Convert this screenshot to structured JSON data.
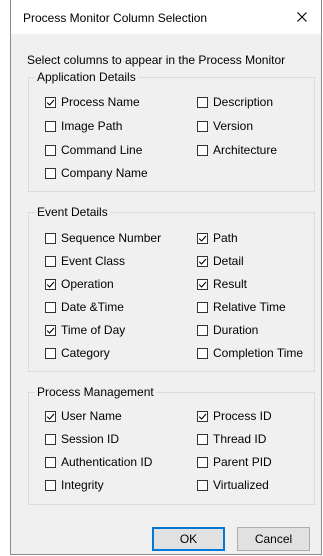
{
  "dialog": {
    "title": "Process Monitor Column Selection",
    "prompt": "Select columns to appear in the Process Monitor",
    "ok_label": "OK",
    "cancel_label": "Cancel"
  },
  "groups": {
    "application": {
      "title": "Application Details",
      "items": [
        {
          "label": "Process Name",
          "checked": true
        },
        {
          "label": "Description",
          "checked": false
        },
        {
          "label": "Image Path",
          "checked": false
        },
        {
          "label": "Version",
          "checked": false
        },
        {
          "label": "Command Line",
          "checked": false
        },
        {
          "label": "Architecture",
          "checked": false
        },
        {
          "label": "Company Name",
          "checked": false
        }
      ]
    },
    "event": {
      "title": "Event Details",
      "items": [
        {
          "label": "Sequence Number",
          "checked": false
        },
        {
          "label": "Path",
          "checked": true
        },
        {
          "label": "Event Class",
          "checked": false
        },
        {
          "label": "Detail",
          "checked": true
        },
        {
          "label": "Operation",
          "checked": true
        },
        {
          "label": "Result",
          "checked": true
        },
        {
          "label": "Date &Time",
          "checked": false
        },
        {
          "label": "Relative Time",
          "checked": false
        },
        {
          "label": "Time of Day",
          "checked": true
        },
        {
          "label": "Duration",
          "checked": false
        },
        {
          "label": "Category",
          "checked": false
        },
        {
          "label": "Completion Time",
          "checked": false
        }
      ]
    },
    "process": {
      "title": "Process Management",
      "items": [
        {
          "label": "User Name",
          "checked": true
        },
        {
          "label": "Process ID",
          "checked": true
        },
        {
          "label": "Session ID",
          "checked": false
        },
        {
          "label": "Thread ID",
          "checked": false
        },
        {
          "label": "Authentication ID",
          "checked": false
        },
        {
          "label": "Parent PID",
          "checked": false
        },
        {
          "label": "Integrity",
          "checked": false
        },
        {
          "label": "Virtualized",
          "checked": false
        }
      ]
    }
  }
}
